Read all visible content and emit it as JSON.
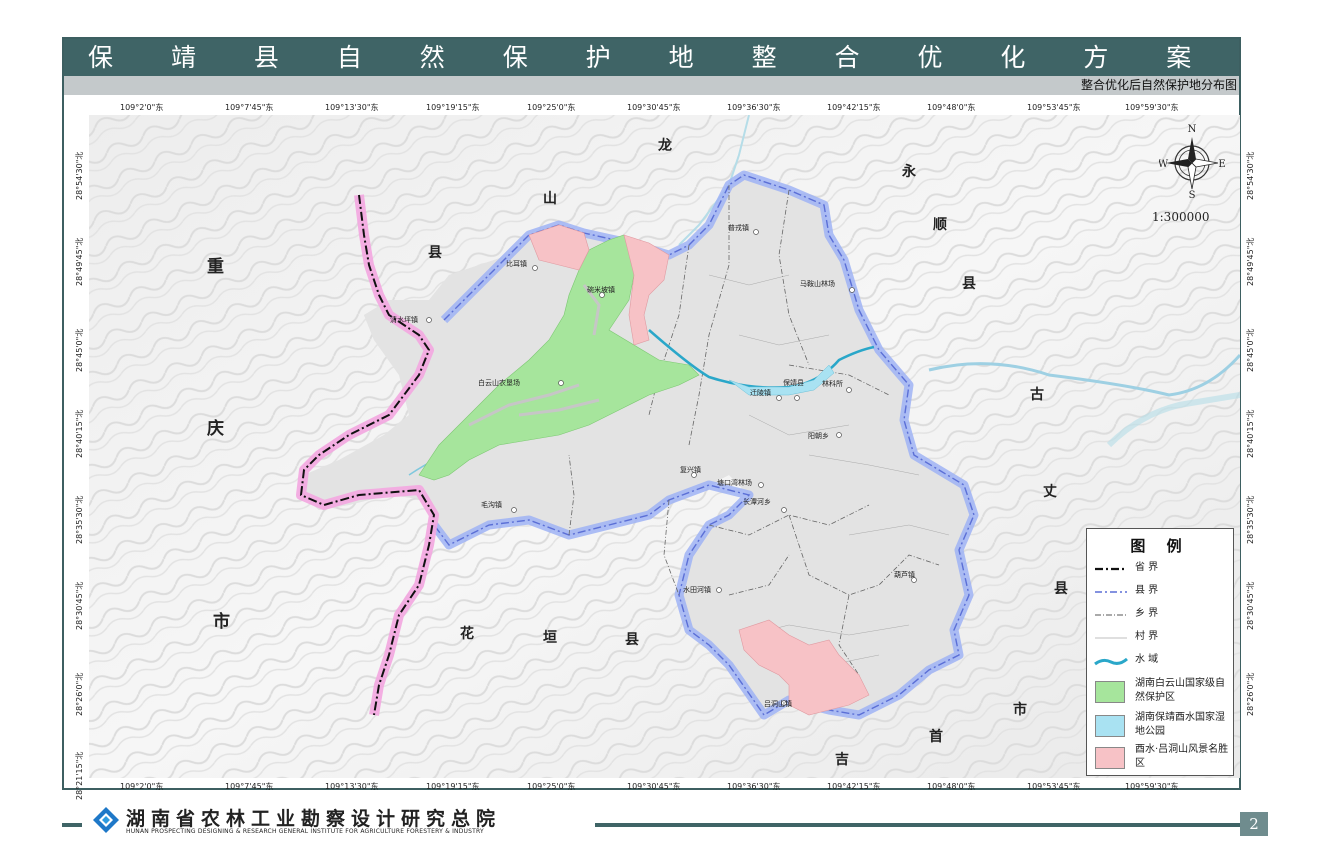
{
  "header": {
    "title": "保 靖 县 自 然 保 护 地 整 合 优 化 方 案",
    "subtitle": "整合优化后自然保护地分布图"
  },
  "top_ticks": [
    "109°2'0\"东",
    "109°7'45\"东",
    "109°13'30\"东",
    "109°19'15\"东",
    "109°25'0\"东",
    "109°30'45\"东",
    "109°36'30\"东",
    "109°42'15\"东",
    "109°48'0\"东",
    "109°53'45\"东",
    "109°59'30\"东"
  ],
  "bottom_ticks": [
    "109°2'0\"东",
    "109°7'45\"东",
    "109°13'30\"东",
    "109°19'15\"东",
    "109°25'0\"东",
    "109°30'45\"东",
    "109°36'30\"东",
    "109°42'15\"东",
    "109°48'0\"东",
    "109°53'45\"东",
    "109°59'30\"东"
  ],
  "left_ticks": [
    "28°54'30\"北",
    "28°49'45\"北",
    "28°45'0\"北",
    "28°40'15\"北",
    "28°35'30\"北",
    "28°30'45\"北",
    "28°26'0\"北",
    "28°21'15\"北"
  ],
  "right_ticks": [
    "28°54'30\"北",
    "28°49'45\"北",
    "28°45'0\"北",
    "28°40'15\"北",
    "28°35'30\"北",
    "28°30'45\"北",
    "28°26'0\"北"
  ],
  "regions": {
    "chongqing": [
      "重",
      "庆",
      "市"
    ],
    "longshan": [
      "龙",
      "山",
      "县"
    ],
    "yongshun": [
      "永",
      "顺",
      "县"
    ],
    "guzhang": [
      "古",
      "丈",
      "县"
    ],
    "jishou": [
      "吉",
      "首",
      "市"
    ],
    "huayuan": [
      "花",
      "垣",
      "县"
    ]
  },
  "towns": [
    "普戎镇",
    "比耳镇",
    "碗米坡镇",
    "马鞍山林场",
    "清水坪镇",
    "白云山农垦场",
    "保靖县",
    "迁陵镇",
    "林科所",
    "阳朝乡",
    "复兴镇",
    "塘口湾林场",
    "长潭河乡",
    "毛沟镇",
    "葫芦镇",
    "水田河镇",
    "吕洞山镇"
  ],
  "compass": {
    "n": "N",
    "s": "S",
    "e": "E",
    "w": "W"
  },
  "scale": "1:300000",
  "legend": {
    "title": "图 例",
    "items": [
      {
        "label": "省 界",
        "type": "province"
      },
      {
        "label": "县 界",
        "type": "county"
      },
      {
        "label": "乡 界",
        "type": "township"
      },
      {
        "label": "村 界",
        "type": "village"
      },
      {
        "label": "水 域",
        "type": "water"
      },
      {
        "label": "湖南白云山国家级自然保护区",
        "type": "fill",
        "color": "#a6e59c"
      },
      {
        "label": "湖南保靖酉水国家湿地公园",
        "type": "fill",
        "color": "#a9e2f2"
      },
      {
        "label": "酉水·吕洞山风景名胜区",
        "type": "fill",
        "color": "#f7c2c6"
      }
    ]
  },
  "colors": {
    "accent": "#3f6466",
    "province_glow": "#f3a6e0",
    "county_glow": "#9fb3f5",
    "reserve": "#a6e59c",
    "scenic": "#f7c2c6",
    "water": "#2aa7c9"
  },
  "footer": {
    "org_cn": "湖南省农林工业勘察设计研究总院",
    "org_en": "HUNAN PROSPECTING DESIGNING & RESEARCH GENERAL INSTITUTE FOR AGRICULTURE FORESTERY & INDUSTRY",
    "page": "2"
  }
}
